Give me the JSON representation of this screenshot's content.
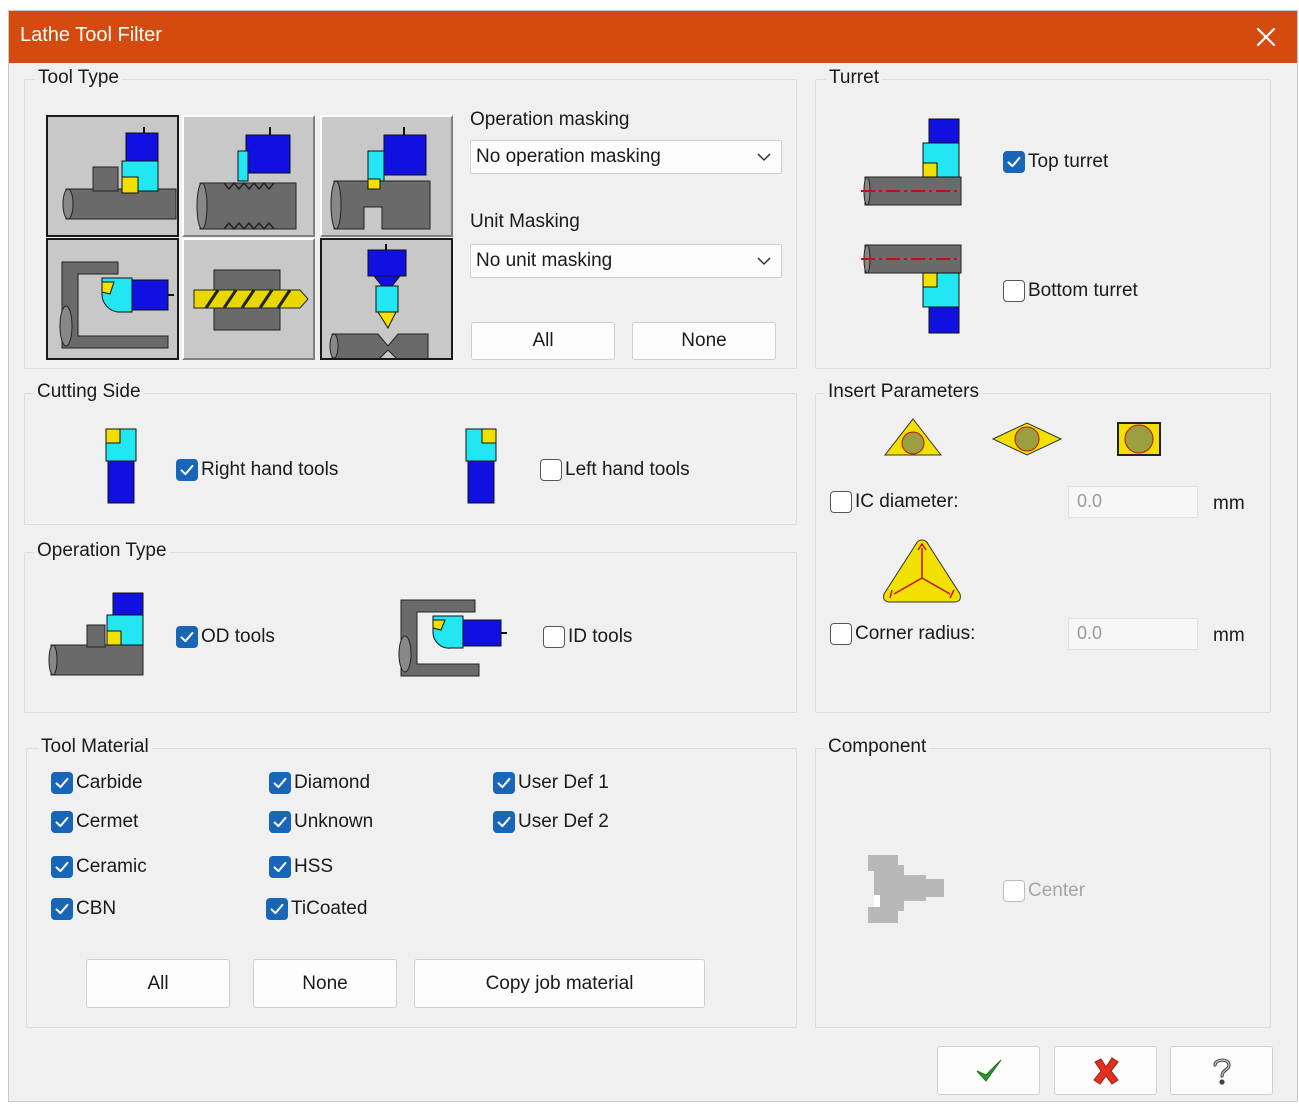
{
  "window": {
    "title": "Lathe Tool Filter",
    "accent_color": "#d54a0f"
  },
  "tool_type": {
    "legend": "Tool Type",
    "tiles": [
      "od-turning-tool",
      "threading-tool",
      "grooving-tool",
      "id-boring-tool",
      "drill-tool",
      "cutoff-tool"
    ],
    "operation_masking_label": "Operation masking",
    "operation_masking_value": "No operation masking",
    "unit_masking_label": "Unit Masking",
    "unit_masking_value": "No unit masking",
    "all_label": "All",
    "none_label": "None"
  },
  "turret": {
    "legend": "Turret",
    "top_label": "Top turret",
    "top_checked": true,
    "bottom_label": "Bottom turret",
    "bottom_checked": false
  },
  "cutting_side": {
    "legend": "Cutting Side",
    "right_label": "Right hand tools",
    "right_checked": true,
    "left_label": "Left hand tools",
    "left_checked": false
  },
  "insert_parameters": {
    "legend": "Insert Parameters",
    "ic_label": "IC diameter:",
    "ic_checked": false,
    "ic_value": "0.0",
    "ic_unit": "mm",
    "corner_label": "Corner radius:",
    "corner_checked": false,
    "corner_value": "0.0",
    "corner_unit": "mm"
  },
  "operation_type": {
    "legend": "Operation Type",
    "od_label": "OD tools",
    "od_checked": true,
    "id_label": "ID tools",
    "id_checked": false
  },
  "tool_material": {
    "legend": "Tool Material",
    "items": [
      {
        "label": "Carbide",
        "checked": true
      },
      {
        "label": "Cermet",
        "checked": true
      },
      {
        "label": "Ceramic",
        "checked": true
      },
      {
        "label": "CBN",
        "checked": true
      },
      {
        "label": "Diamond",
        "checked": true
      },
      {
        "label": "Unknown",
        "checked": true
      },
      {
        "label": "HSS",
        "checked": true
      },
      {
        "label": "TiCoated",
        "checked": true
      },
      {
        "label": "User Def 1",
        "checked": true
      },
      {
        "label": "User Def 2",
        "checked": true
      }
    ],
    "all_label": "All",
    "none_label": "None",
    "copy_label": "Copy job material"
  },
  "component": {
    "legend": "Component",
    "center_label": "Center",
    "center_checked": false
  },
  "footer": {
    "ok_icon": "green-check-icon",
    "cancel_icon": "red-x-icon",
    "help_icon": "question-mark-icon"
  }
}
